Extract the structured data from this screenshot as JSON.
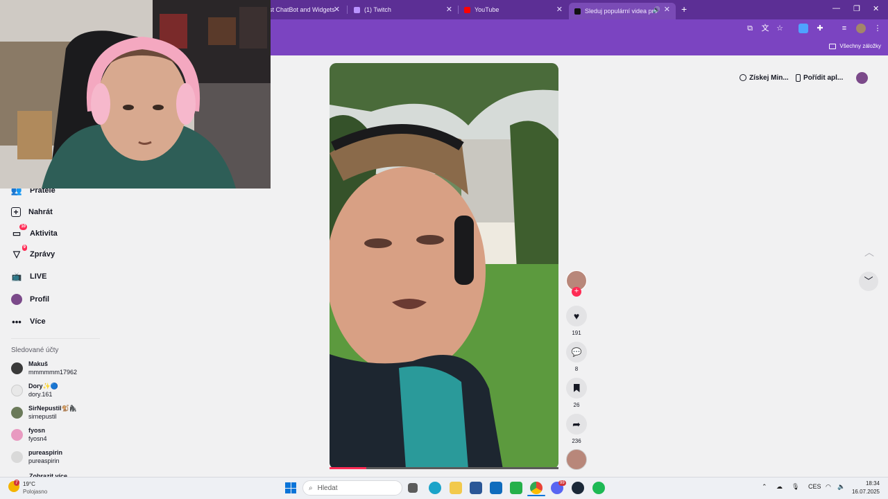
{
  "browser": {
    "tabs": [
      {
        "label": "st ChatBot and Widgets",
        "active": false,
        "fav_color": "#ffffff"
      },
      {
        "label": "(1) Twitch",
        "active": false,
        "fav_color": "#9146ff"
      },
      {
        "label": "YouTube",
        "active": false,
        "fav_color": "#ff0000"
      },
      {
        "label": "Sleduj populární videa pro",
        "active": true,
        "fav_color": "#000000"
      }
    ],
    "bookmarks_all": "Všechny záložky"
  },
  "sidebar": {
    "items": [
      {
        "label": "Přátelé",
        "icon": "friends-icon",
        "badge": ""
      },
      {
        "label": "Nahrát",
        "icon": "upload-icon",
        "badge": ""
      },
      {
        "label": "Aktivita",
        "icon": "activity-icon",
        "badge": "10"
      },
      {
        "label": "Zprávy",
        "icon": "messages-icon",
        "badge": "9"
      },
      {
        "label": "LIVE",
        "icon": "live-icon",
        "badge": ""
      },
      {
        "label": "Profil",
        "icon": "profile-avatar",
        "badge": ""
      },
      {
        "label": "Více",
        "icon": "more-icon",
        "badge": ""
      }
    ],
    "followed_title": "Sledované účty",
    "accounts": [
      {
        "name": "Makuš",
        "username": "mmmmmm17962"
      },
      {
        "name": "Dory✨🔵",
        "username": "dory.161"
      },
      {
        "name": "SirNepustil🐒🦍",
        "username": "sirnepustil"
      },
      {
        "name": "fyosn",
        "username": "fyosn4"
      },
      {
        "name": "pureaspirin",
        "username": "pureaspirin"
      }
    ],
    "show_more": "Zobrazit více"
  },
  "header_buttons": {
    "coins": "Získej Min...",
    "app": "Pořídit apl..."
  },
  "actions": {
    "likes": "191",
    "comments": "8",
    "saves": "26",
    "shares": "236"
  },
  "video": {
    "progress": 0.16
  },
  "taskbar": {
    "weather_temp": "19°C",
    "weather_desc": "Polojasno",
    "weather_badge": "7",
    "search_placeholder": "Hledat",
    "discord_badge": "99",
    "lang": "CES",
    "time": "18:34",
    "date": "16.07.2025"
  }
}
